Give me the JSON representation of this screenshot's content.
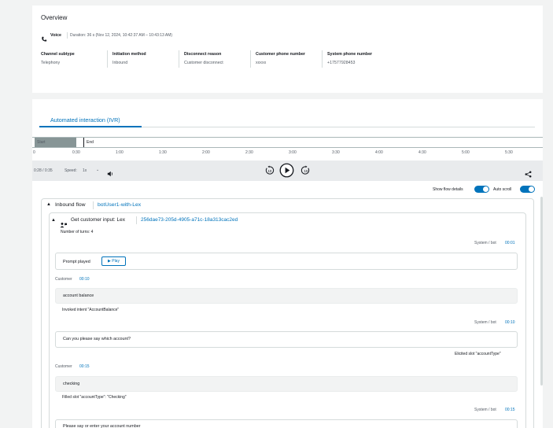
{
  "overview": {
    "title": "Overview",
    "channel": "Voice",
    "duration": "Duration: 36 s (Nov 12, 2024, 10:42:37 AM – 10:43:13 AM)",
    "fields": [
      {
        "label": "Channel subtype",
        "value": "Telephony"
      },
      {
        "label": "Initiation method",
        "value": "Inbound"
      },
      {
        "label": "Disconnect reason",
        "value": "Customer disconnect"
      },
      {
        "label": "Customer phone number",
        "value": "xxxxx"
      },
      {
        "label": "System phone number",
        "value": "+17577928453"
      }
    ]
  },
  "tabs": [
    {
      "label": "Automated interaction (IVR)",
      "active": true
    }
  ],
  "timeline": {
    "start_label": "Start",
    "end_label": "End",
    "ticks": [
      "0",
      "0:30",
      "1:00",
      "1:30",
      "2:00",
      "2:30",
      "3:00",
      "3:30",
      "4:00",
      "4:30",
      "5:00",
      "5:30"
    ]
  },
  "player": {
    "position": "0:28 / 0:35",
    "speed_label": "Speed:",
    "speed_value": "1x",
    "rewind_icon": "rewind-10-icon",
    "play_icon": "play-icon",
    "forward_icon": "forward-10-icon",
    "volume_icon": "volume-icon",
    "share_icon": "share-icon"
  },
  "toggles": {
    "show_flow_details": "Show flow details",
    "auto_scroll": "Auto scroll"
  },
  "flow": {
    "title": "Inbound flow",
    "name": "botUser1-with-Lex",
    "block": {
      "title": "Get customer input: Lex",
      "id": "256dae73-205d-4905-a71c-18a313cac2ed",
      "turns": "Number of turns: 4"
    }
  },
  "transcript": {
    "system_label": "System / bot",
    "customer_label": "Customer",
    "time1": "00:01",
    "prompt_played": "Prompt played",
    "play_button": "▶ Play",
    "customer_time1": "00:10",
    "utterance1": "account balance",
    "intent": "Invoked intent \"AccountBalance\"",
    "time2": "00:10",
    "bot_msg1": "Can you please say which account?",
    "elicited": "Elicited slot \"accountType\"",
    "customer_time2": "00:15",
    "utterance2": "checking",
    "filled": "Filled slot \"accountType\": \"Checking\"",
    "time3": "00:15",
    "bot_msg2": "Please say or enter your account number"
  }
}
